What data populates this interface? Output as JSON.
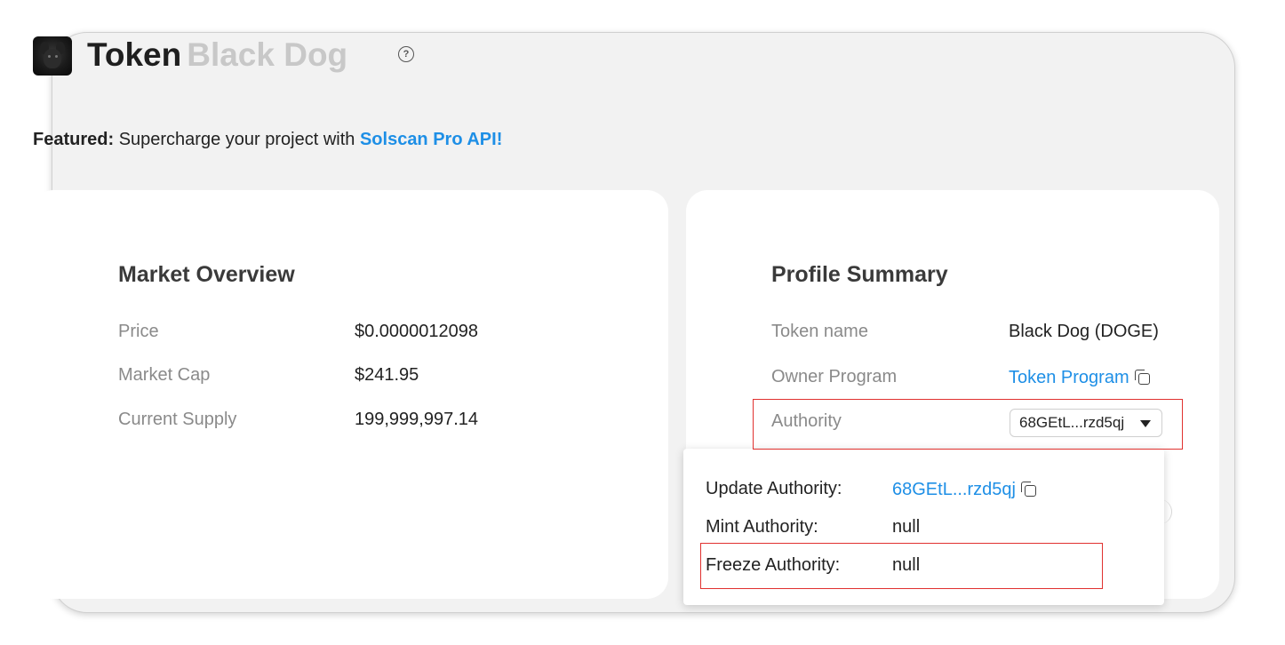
{
  "header": {
    "title_main": "Token",
    "title_sub": "Black Dog",
    "help_icon": "question-circle-icon",
    "logo_icon": "black-dog-token-logo"
  },
  "featured": {
    "label": "Featured:",
    "text": "Supercharge your project with",
    "link": "Solscan Pro API!"
  },
  "market_overview": {
    "title": "Market Overview",
    "rows": [
      {
        "label": "Price",
        "value": "$0.0000012098"
      },
      {
        "label": "Market Cap",
        "value": "$241.95"
      },
      {
        "label": "Current Supply",
        "value": "199,999,997.14"
      }
    ]
  },
  "profile_summary": {
    "title": "Profile Summary",
    "token_name_label": "Token name",
    "token_name_value": "Black Dog (DOGE)",
    "owner_program_label": "Owner Program",
    "owner_program_value": "Token Program",
    "authority_label": "Authority",
    "authority_selected": "68GEtL...rzd5qj"
  },
  "authority_popover": {
    "update_label": "Update Authority:",
    "update_value": "68GEtL...rzd5qj",
    "mint_label": "Mint Authority:",
    "mint_value": "null",
    "freeze_label": "Freeze Authority:",
    "freeze_value": "null"
  },
  "colors": {
    "link": "#1e8fe6",
    "highlight": "#e0312f",
    "page_bg": "#f2f2f2",
    "card_bg": "#ffffff"
  }
}
